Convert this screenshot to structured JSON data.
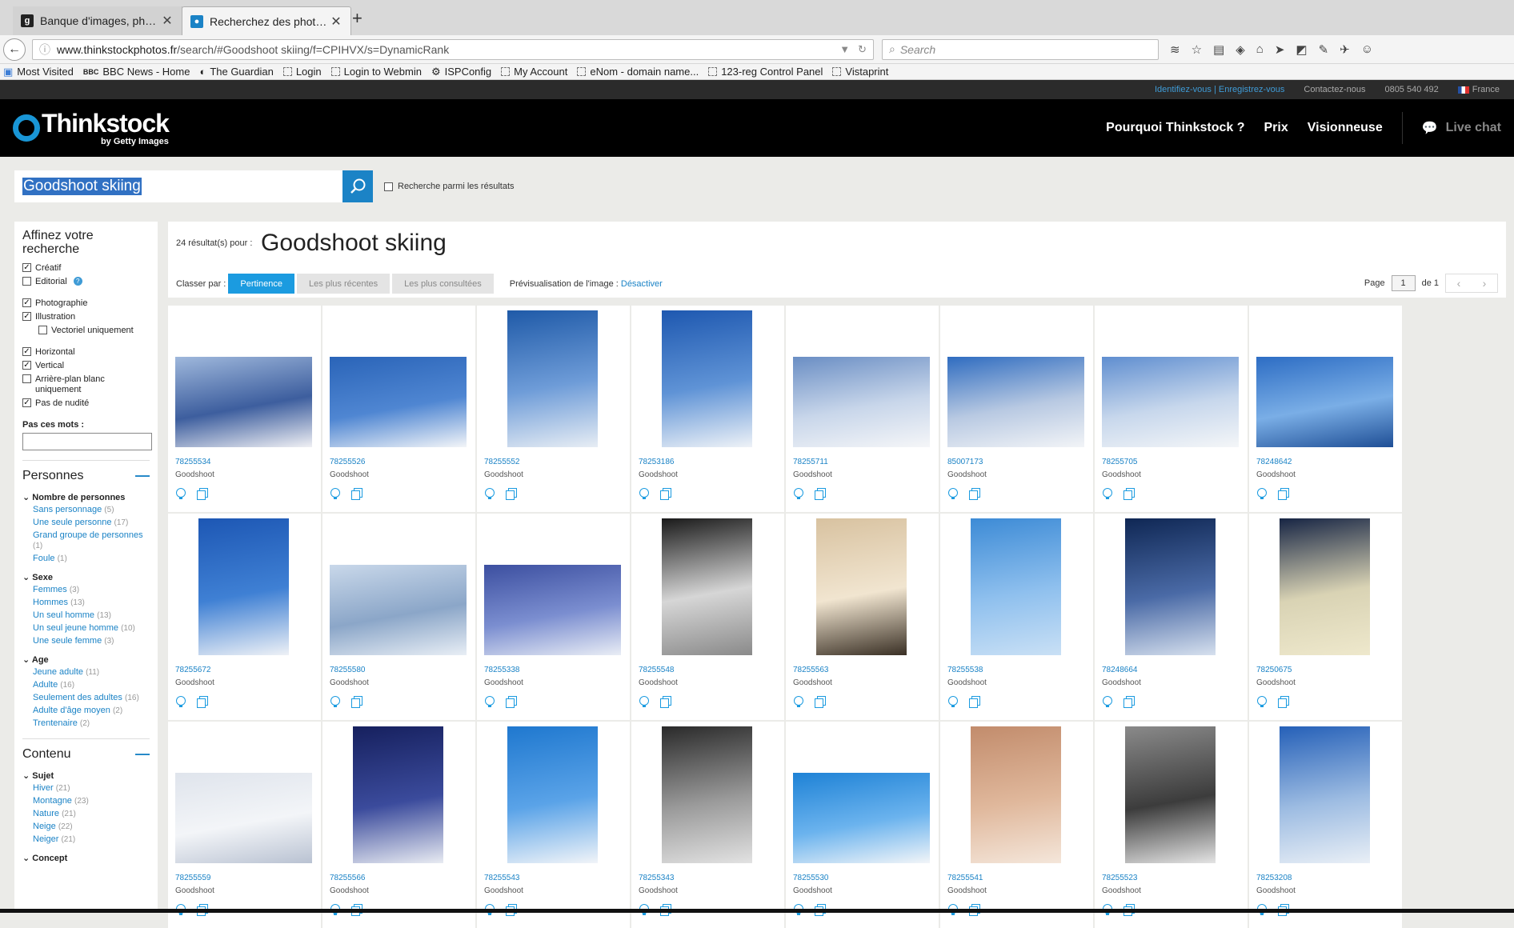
{
  "browser": {
    "tabs": [
      {
        "title": "Banque d'images, photos ...",
        "favicon_color": "#222222",
        "favicon_char": "g",
        "active": false
      },
      {
        "title": "Recherchez des photos de...",
        "favicon_color": "#1b83c6",
        "favicon_char": "",
        "active": true
      }
    ],
    "url_host": "www.thinkstockphotos.fr",
    "url_path": "/search/#Goodshoot skiing/f=CPIHVX/s=DynamicRank",
    "search_placeholder": "Search",
    "bookmarks": [
      "Most Visited",
      "BBC News - Home",
      "The Guardian",
      "Login",
      "Login to Webmin",
      "ISPConfig",
      "My Account",
      "eNom - domain name...",
      "123-reg Control Panel",
      "Vistaprint"
    ]
  },
  "site": {
    "topstrip": {
      "login": "Identifiez-vous",
      "register": "| Enregistrez-vous",
      "contact": "Contactez-nous",
      "phone": "0805 540 492",
      "country": "France"
    },
    "logo": {
      "name": "Thinkstock",
      "sub": "by Getty Images"
    },
    "nav": {
      "why": "Pourquoi Thinkstock ?",
      "price": "Prix",
      "viewer": "Visionneuse",
      "chat": "Live chat"
    },
    "search": {
      "query": "Goodshoot skiing",
      "within_label": "Recherche parmi les résultats"
    }
  },
  "sidebar": {
    "title": "Affinez votre recherche",
    "filters": {
      "creative": "Créatif",
      "editorial": "Editorial",
      "photo": "Photographie",
      "illustration": "Illustration",
      "vector": "Vectoriel uniquement",
      "horizontal": "Horizontal",
      "vertical": "Vertical",
      "white_bg": "Arrière-plan blanc uniquement",
      "no_nudity": "Pas de nudité"
    },
    "exclude_label": "Pas ces mots :",
    "people_title": "Personnes",
    "count_title": "Nombre de personnes",
    "count_items": [
      {
        "label": "Sans personnage",
        "count": "(5)"
      },
      {
        "label": "Une seule personne",
        "count": "(17)"
      },
      {
        "label": "Grand groupe de personnes",
        "count": "(1)"
      },
      {
        "label": "Foule",
        "count": "(1)"
      }
    ],
    "sex_title": "Sexe",
    "sex_items": [
      {
        "label": "Femmes",
        "count": "(3)"
      },
      {
        "label": "Hommes",
        "count": "(13)"
      },
      {
        "label": "Un seul homme",
        "count": "(13)"
      },
      {
        "label": "Un seul jeune homme",
        "count": "(10)"
      },
      {
        "label": "Une seule femme",
        "count": "(3)"
      }
    ],
    "age_title": "Age",
    "age_items": [
      {
        "label": "Jeune adulte",
        "count": "(11)"
      },
      {
        "label": "Adulte",
        "count": "(16)"
      },
      {
        "label": "Seulement des adultes",
        "count": "(16)"
      },
      {
        "label": "Adulte d'âge moyen",
        "count": "(2)"
      },
      {
        "label": "Trentenaire",
        "count": "(2)"
      }
    ],
    "content_title": "Contenu",
    "subject_title": "Sujet",
    "subject_items": [
      {
        "label": "Hiver",
        "count": "(21)"
      },
      {
        "label": "Montagne",
        "count": "(23)"
      },
      {
        "label": "Nature",
        "count": "(21)"
      },
      {
        "label": "Neige",
        "count": "(22)"
      },
      {
        "label": "Neiger",
        "count": "(21)"
      }
    ],
    "concept_title": "Concept"
  },
  "results": {
    "count_label": "24 résultat(s) pour :",
    "query": "Goodshoot skiing",
    "sort_label": "Classer par :",
    "sort_options": [
      "Pertinence",
      "Les plus récentes",
      "Les plus consultées"
    ],
    "preview_label": "Prévisualisation de l'image :",
    "preview_toggle": "Désactiver",
    "page_label": "Page",
    "page_value": "1",
    "page_of": "de 1"
  },
  "images": [
    {
      "id": "78255534",
      "collection": "Goodshoot",
      "orientation": "horizontal",
      "colors": [
        "#9fb8dc",
        "#3d5e9e",
        "#f0f0f4"
      ]
    },
    {
      "id": "78255526",
      "collection": "Goodshoot",
      "orientation": "horizontal",
      "colors": [
        "#2a64b8",
        "#4f86d2",
        "#f3f5f8"
      ]
    },
    {
      "id": "78255552",
      "collection": "Goodshoot",
      "orientation": "vertical",
      "colors": [
        "#1f5aa8",
        "#6e9cd8",
        "#e7edf4"
      ]
    },
    {
      "id": "78253186",
      "collection": "Goodshoot",
      "orientation": "vertical",
      "colors": [
        "#1e58b0",
        "#5f93d6",
        "#eef2f7"
      ]
    },
    {
      "id": "78255711",
      "collection": "Goodshoot",
      "orientation": "horizontal",
      "colors": [
        "#6a8ec4",
        "#c8d6ea",
        "#f5f6f8"
      ]
    },
    {
      "id": "85007173",
      "collection": "Goodshoot",
      "orientation": "horizontal",
      "colors": [
        "#2f6cc0",
        "#b8c9e2",
        "#f2f4f7"
      ]
    },
    {
      "id": "78255705",
      "collection": "Goodshoot",
      "orientation": "horizontal",
      "colors": [
        "#5f8ed0",
        "#c7d7ec",
        "#f4f6f8"
      ]
    },
    {
      "id": "78248642",
      "collection": "Goodshoot",
      "orientation": "horizontal",
      "colors": [
        "#2d6dc4",
        "#7aaee6",
        "#1f4f96"
      ]
    },
    {
      "id": "78255672",
      "collection": "Goodshoot",
      "orientation": "vertical",
      "colors": [
        "#1d57b4",
        "#3f80d4",
        "#eef1f6"
      ]
    },
    {
      "id": "78255580",
      "collection": "Goodshoot",
      "orientation": "horizontal",
      "colors": [
        "#c9d8ea",
        "#8ba6c8",
        "#e8eef5"
      ]
    },
    {
      "id": "78255338",
      "collection": "Goodshoot",
      "orientation": "horizontal",
      "colors": [
        "#3c4fa0",
        "#7b8ed0",
        "#e9edf5"
      ]
    },
    {
      "id": "78255548",
      "collection": "Goodshoot",
      "orientation": "vertical",
      "colors": [
        "#1a1a1a",
        "#d6d6d6",
        "#8a8a8a"
      ]
    },
    {
      "id": "78255563",
      "collection": "Goodshoot",
      "orientation": "vertical",
      "colors": [
        "#d8c2a0",
        "#f1e5d0",
        "#3a3025"
      ]
    },
    {
      "id": "78255538",
      "collection": "Goodshoot",
      "orientation": "vertical",
      "colors": [
        "#3d8bd6",
        "#8fc0ee",
        "#c9e0f5"
      ]
    },
    {
      "id": "78248664",
      "collection": "Goodshoot",
      "orientation": "vertical",
      "colors": [
        "#0f2754",
        "#4a6aa6",
        "#d6e0ee"
      ]
    },
    {
      "id": "78250675",
      "collection": "Goodshoot",
      "orientation": "vertical",
      "colors": [
        "#172544",
        "#d9d3b4",
        "#eee8cc"
      ]
    },
    {
      "id": "78255559",
      "collection": "Goodshoot",
      "orientation": "horizontal",
      "colors": [
        "#dfe4ec",
        "#f3f5f8",
        "#b9c2d2"
      ]
    },
    {
      "id": "78255566",
      "collection": "Goodshoot",
      "orientation": "vertical",
      "colors": [
        "#16205e",
        "#3b4b9c",
        "#e8ebf2"
      ]
    },
    {
      "id": "78255543",
      "collection": "Goodshoot",
      "orientation": "vertical",
      "colors": [
        "#1f78cf",
        "#5aa3e8",
        "#f1f4f8"
      ]
    },
    {
      "id": "78255343",
      "collection": "Goodshoot",
      "orientation": "vertical",
      "colors": [
        "#2a2a2a",
        "#9a9a9a",
        "#e2e2e2"
      ]
    },
    {
      "id": "78255530",
      "collection": "Goodshoot",
      "orientation": "horizontal",
      "colors": [
        "#1e82d6",
        "#6bb3ee",
        "#f2f5f8"
      ]
    },
    {
      "id": "78255541",
      "collection": "Goodshoot",
      "orientation": "vertical",
      "colors": [
        "#c28c6c",
        "#e0b89c",
        "#f4e6da"
      ]
    },
    {
      "id": "78255523",
      "collection": "Goodshoot",
      "orientation": "vertical",
      "colors": [
        "#8a8a8a",
        "#3c3c3c",
        "#e4e4e4"
      ]
    },
    {
      "id": "78253208",
      "collection": "Goodshoot",
      "orientation": "vertical",
      "colors": [
        "#2560b8",
        "#9dbce2",
        "#e9eff6"
      ]
    }
  ]
}
